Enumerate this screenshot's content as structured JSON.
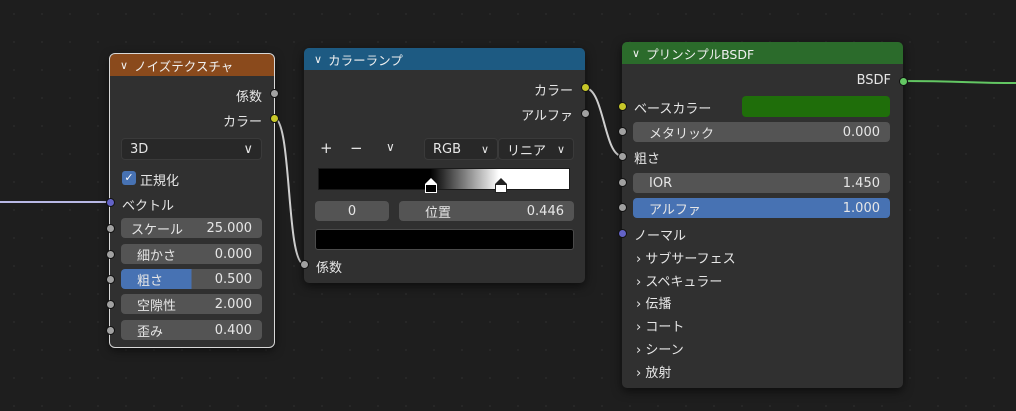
{
  "noise_node": {
    "title": "ノイズテクスチャ",
    "out_fac": "係数",
    "out_color": "カラー",
    "dimension": "3D",
    "normalize_label": "正規化",
    "vector_label": "ベクトル",
    "params": [
      {
        "label": "スケール",
        "value": "25.000"
      },
      {
        "label": "細かさ",
        "value": "0.000"
      },
      {
        "label": "粗さ",
        "value": "0.500"
      },
      {
        "label": "空隙性",
        "value": "2.000"
      },
      {
        "label": "歪み",
        "value": "0.400"
      }
    ]
  },
  "ramp_node": {
    "title": "カラーランプ",
    "out_color": "カラー",
    "out_alpha": "アルファ",
    "add_icon": "plus-icon",
    "remove_icon": "minus-icon",
    "color_mode": "RGB",
    "interpolation": "リニア",
    "stop_index": "0",
    "position_label": "位置",
    "position_value": "0.446",
    "in_fac": "係数",
    "stop_color": "#000000"
  },
  "bsdf_node": {
    "title": "プリンシプルBSDF",
    "out_bsdf": "BSDF",
    "base_color_label": "ベースカラー",
    "base_color": "#1f6e0a",
    "metallic_label": "メタリック",
    "metallic_value": "0.000",
    "roughness_label": "粗さ",
    "ior_label": "IOR",
    "ior_value": "1.450",
    "alpha_label": "アルファ",
    "alpha_value": "1.000",
    "normal_label": "ノーマル",
    "panels": [
      "サブサーフェス",
      "スペキュラー",
      "伝播",
      "コート",
      "シーン",
      "放射"
    ]
  },
  "colors": {
    "noise_header": "#8a4a1c",
    "ramp_header": "#1d5a82",
    "bsdf_header": "#2b6b2b",
    "selection": "#4772b3"
  }
}
